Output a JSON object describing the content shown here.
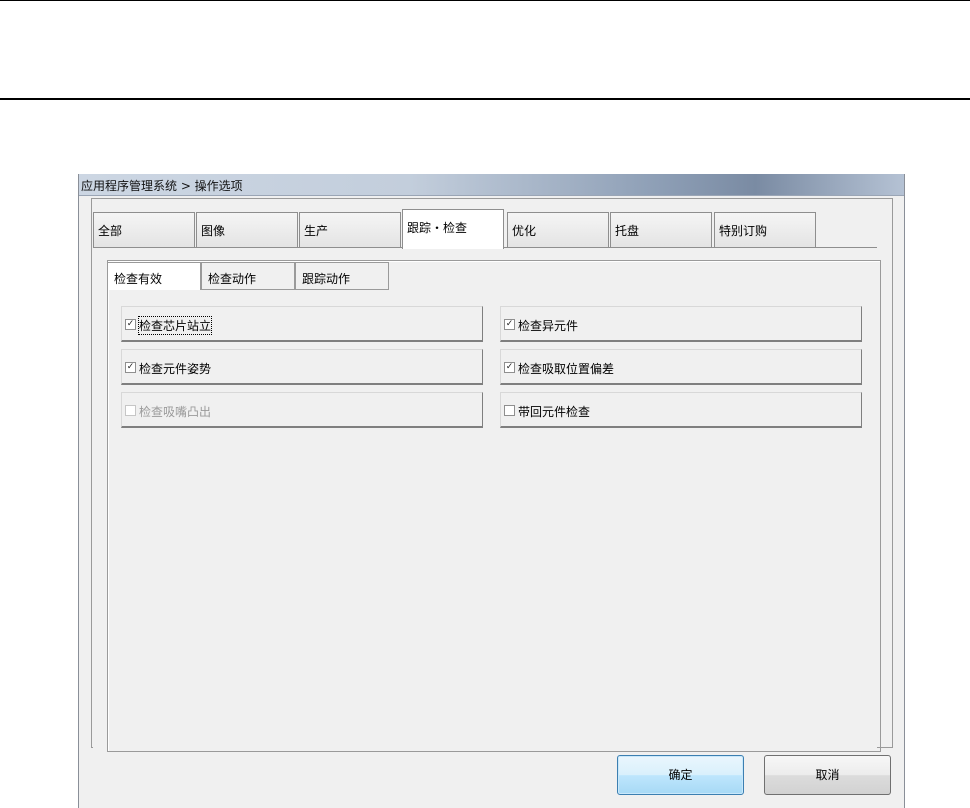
{
  "window": {
    "title": "应用程序管理系统 > 操作选项"
  },
  "tabs": [
    {
      "label": "全部",
      "active": false
    },
    {
      "label": "图像",
      "active": false
    },
    {
      "label": "生产",
      "active": false
    },
    {
      "label": "跟踪・检查",
      "active": true
    },
    {
      "label": "优化",
      "active": false
    },
    {
      "label": "托盘",
      "active": false
    },
    {
      "label": "特别订购",
      "active": false
    }
  ],
  "subtabs": [
    {
      "label": "检查有效",
      "active": true
    },
    {
      "label": "检查动作",
      "active": false
    },
    {
      "label": "跟踪动作",
      "active": false
    }
  ],
  "options": {
    "left": [
      {
        "label": "检查芯片站立",
        "checked": true,
        "enabled": true
      },
      {
        "label": "检查元件姿势",
        "checked": true,
        "enabled": true
      },
      {
        "label": "检查吸嘴凸出",
        "checked": false,
        "enabled": false
      }
    ],
    "right": [
      {
        "label": "检查异元件",
        "checked": true,
        "enabled": true
      },
      {
        "label": "检查吸取位置偏差",
        "checked": true,
        "enabled": true
      },
      {
        "label": "带回元件检查",
        "checked": false,
        "enabled": true
      }
    ]
  },
  "buttons": {
    "ok": "确定",
    "cancel": "取消"
  },
  "glyphs": {
    "check": "✓",
    "empty": ""
  }
}
